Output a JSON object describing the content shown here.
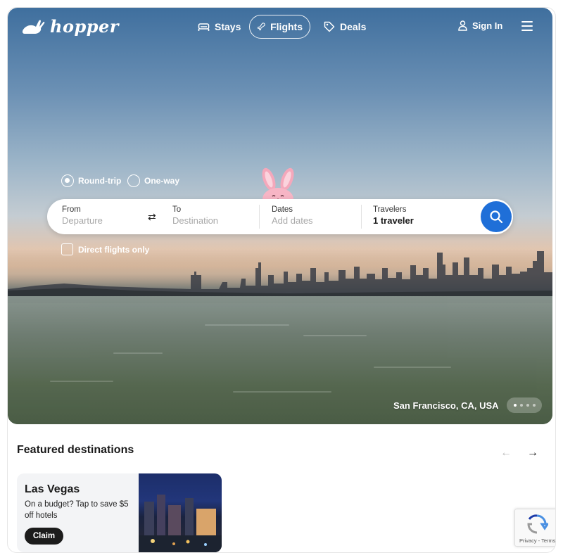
{
  "nav": {
    "brand": "hopper",
    "stays": "Stays",
    "flights": "Flights",
    "deals": "Deals",
    "sign_in": "Sign In"
  },
  "search": {
    "round_trip": "Round-trip",
    "one_way": "One-way",
    "selected_trip_type": "Round-trip",
    "from_label": "From",
    "from_placeholder": "Departure",
    "to_label": "To",
    "to_placeholder": "Destination",
    "dates_label": "Dates",
    "dates_placeholder": "Add dates",
    "travelers_label": "Travelers",
    "travelers_value": "1 traveler",
    "direct_flights": "Direct flights only"
  },
  "hero": {
    "location": "San Francisco, CA, USA",
    "slide_count": 4,
    "active_slide": 1
  },
  "featured": {
    "title": "Featured destinations",
    "cards": [
      {
        "title": "Las Vegas",
        "description": "On a budget? Tap to save $5 off hotels",
        "cta": "Claim"
      }
    ]
  },
  "recaptcha": {
    "text": "Privacy - Terms"
  },
  "colors": {
    "accent": "#1f6fd8",
    "text_dark": "#1a1a1a"
  }
}
